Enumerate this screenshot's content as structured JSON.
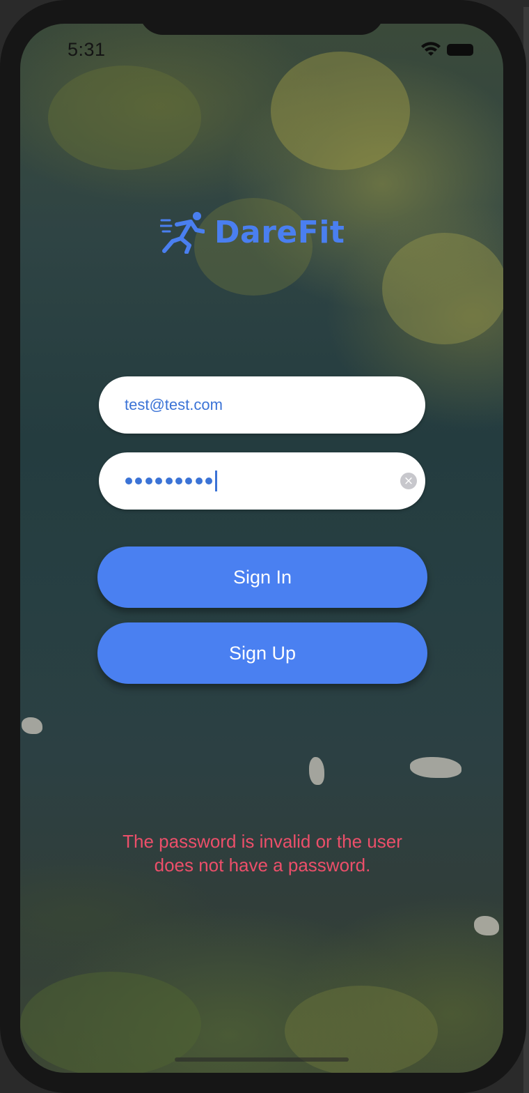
{
  "status_bar": {
    "time": "5:31"
  },
  "brand": {
    "name": "DareFit",
    "logo_icon": "running-person-icon",
    "color": "#4a7ff0"
  },
  "login_form": {
    "email_value": "test@test.com",
    "password_value": "•••••••••",
    "password_clear_icon": "clear-icon",
    "sign_in_label": "Sign In",
    "sign_up_label": "Sign Up",
    "button_color": "#4a80f1"
  },
  "error": {
    "message_line1": "The password is invalid or the user",
    "message_line2": "does not have a password.",
    "color": "#ec4f6a"
  }
}
